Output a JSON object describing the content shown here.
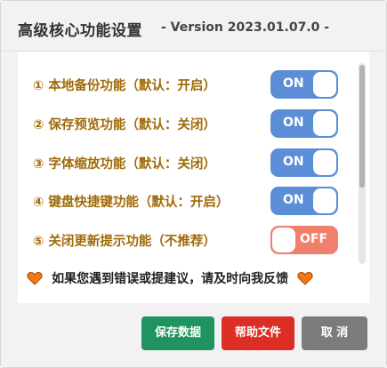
{
  "dialog": {
    "title": "高级核心功能设置",
    "version": "- Version 2023.01.07.0 -"
  },
  "options": [
    {
      "label": "① 本地备份功能（默认：开启）",
      "state": "ON"
    },
    {
      "label": "② 保存预览功能（默认：关闭）",
      "state": "ON"
    },
    {
      "label": "③ 字体缩放功能（默认：关闭）",
      "state": "ON"
    },
    {
      "label": "④ 键盘快捷键功能（默认：开启）",
      "state": "ON"
    },
    {
      "label": "⑤ 关闭更新提示功能（不推荐）",
      "state": "OFF"
    }
  ],
  "feedback": {
    "text": "如果您遇到错误或提建议，请及时向我反馈",
    "icon": "heart-icon"
  },
  "buttons": {
    "save": "保存数据",
    "help": "帮助文件",
    "cancel": "取 消"
  },
  "colors": {
    "label": "#a06a08",
    "toggle_on": "#5b8ed6",
    "toggle_off": "#f07f6c",
    "save": "#1f9460",
    "help": "#dc2e25",
    "cancel": "#7b7b7b",
    "heart": "#f07818"
  }
}
